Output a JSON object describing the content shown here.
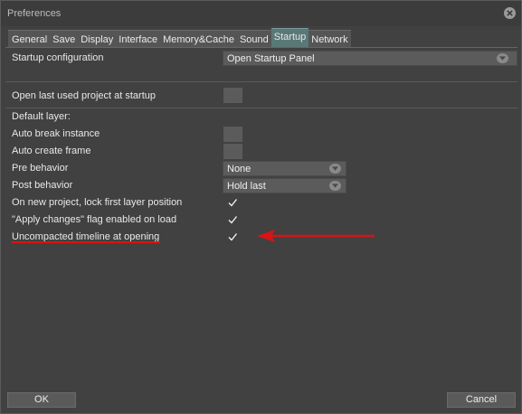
{
  "window": {
    "title": "Preferences"
  },
  "tabs": [
    {
      "label": "General",
      "active": false
    },
    {
      "label": "Save",
      "active": false
    },
    {
      "label": "Display",
      "active": false
    },
    {
      "label": "Interface",
      "active": false
    },
    {
      "label": "Memory&Cache",
      "active": false
    },
    {
      "label": "Sound",
      "active": false
    },
    {
      "label": "Startup",
      "active": true
    },
    {
      "label": "Network",
      "active": false
    }
  ],
  "settings": {
    "startup_configuration": {
      "label": "Startup configuration",
      "value": "Open Startup Panel"
    },
    "open_last_project": {
      "label": "Open last used project at startup",
      "checked": false
    },
    "default_layer_heading": "Default layer:",
    "auto_break_instance": {
      "label": "Auto break instance",
      "checked": false
    },
    "auto_create_frame": {
      "label": "Auto create frame",
      "checked": false
    },
    "pre_behavior": {
      "label": "Pre behavior",
      "value": "None"
    },
    "post_behavior": {
      "label": "Post behavior",
      "value": "Hold last"
    },
    "lock_first_layer": {
      "label": "On new project, lock first layer position",
      "checked": true
    },
    "apply_changes_flag": {
      "label": "\"Apply changes\" flag enabled on load",
      "checked": true
    },
    "uncompacted_timeline": {
      "label": "Uncompacted timeline at opening",
      "checked": true
    }
  },
  "footer": {
    "ok_label": "OK",
    "cancel_label": "Cancel"
  },
  "colors": {
    "annotation_red": "#d81414",
    "active_tab": "#5a7878"
  },
  "icons": {
    "close": "close-circle-icon",
    "dropdown": "chevron-down-icon",
    "check": "checkmark-icon"
  }
}
